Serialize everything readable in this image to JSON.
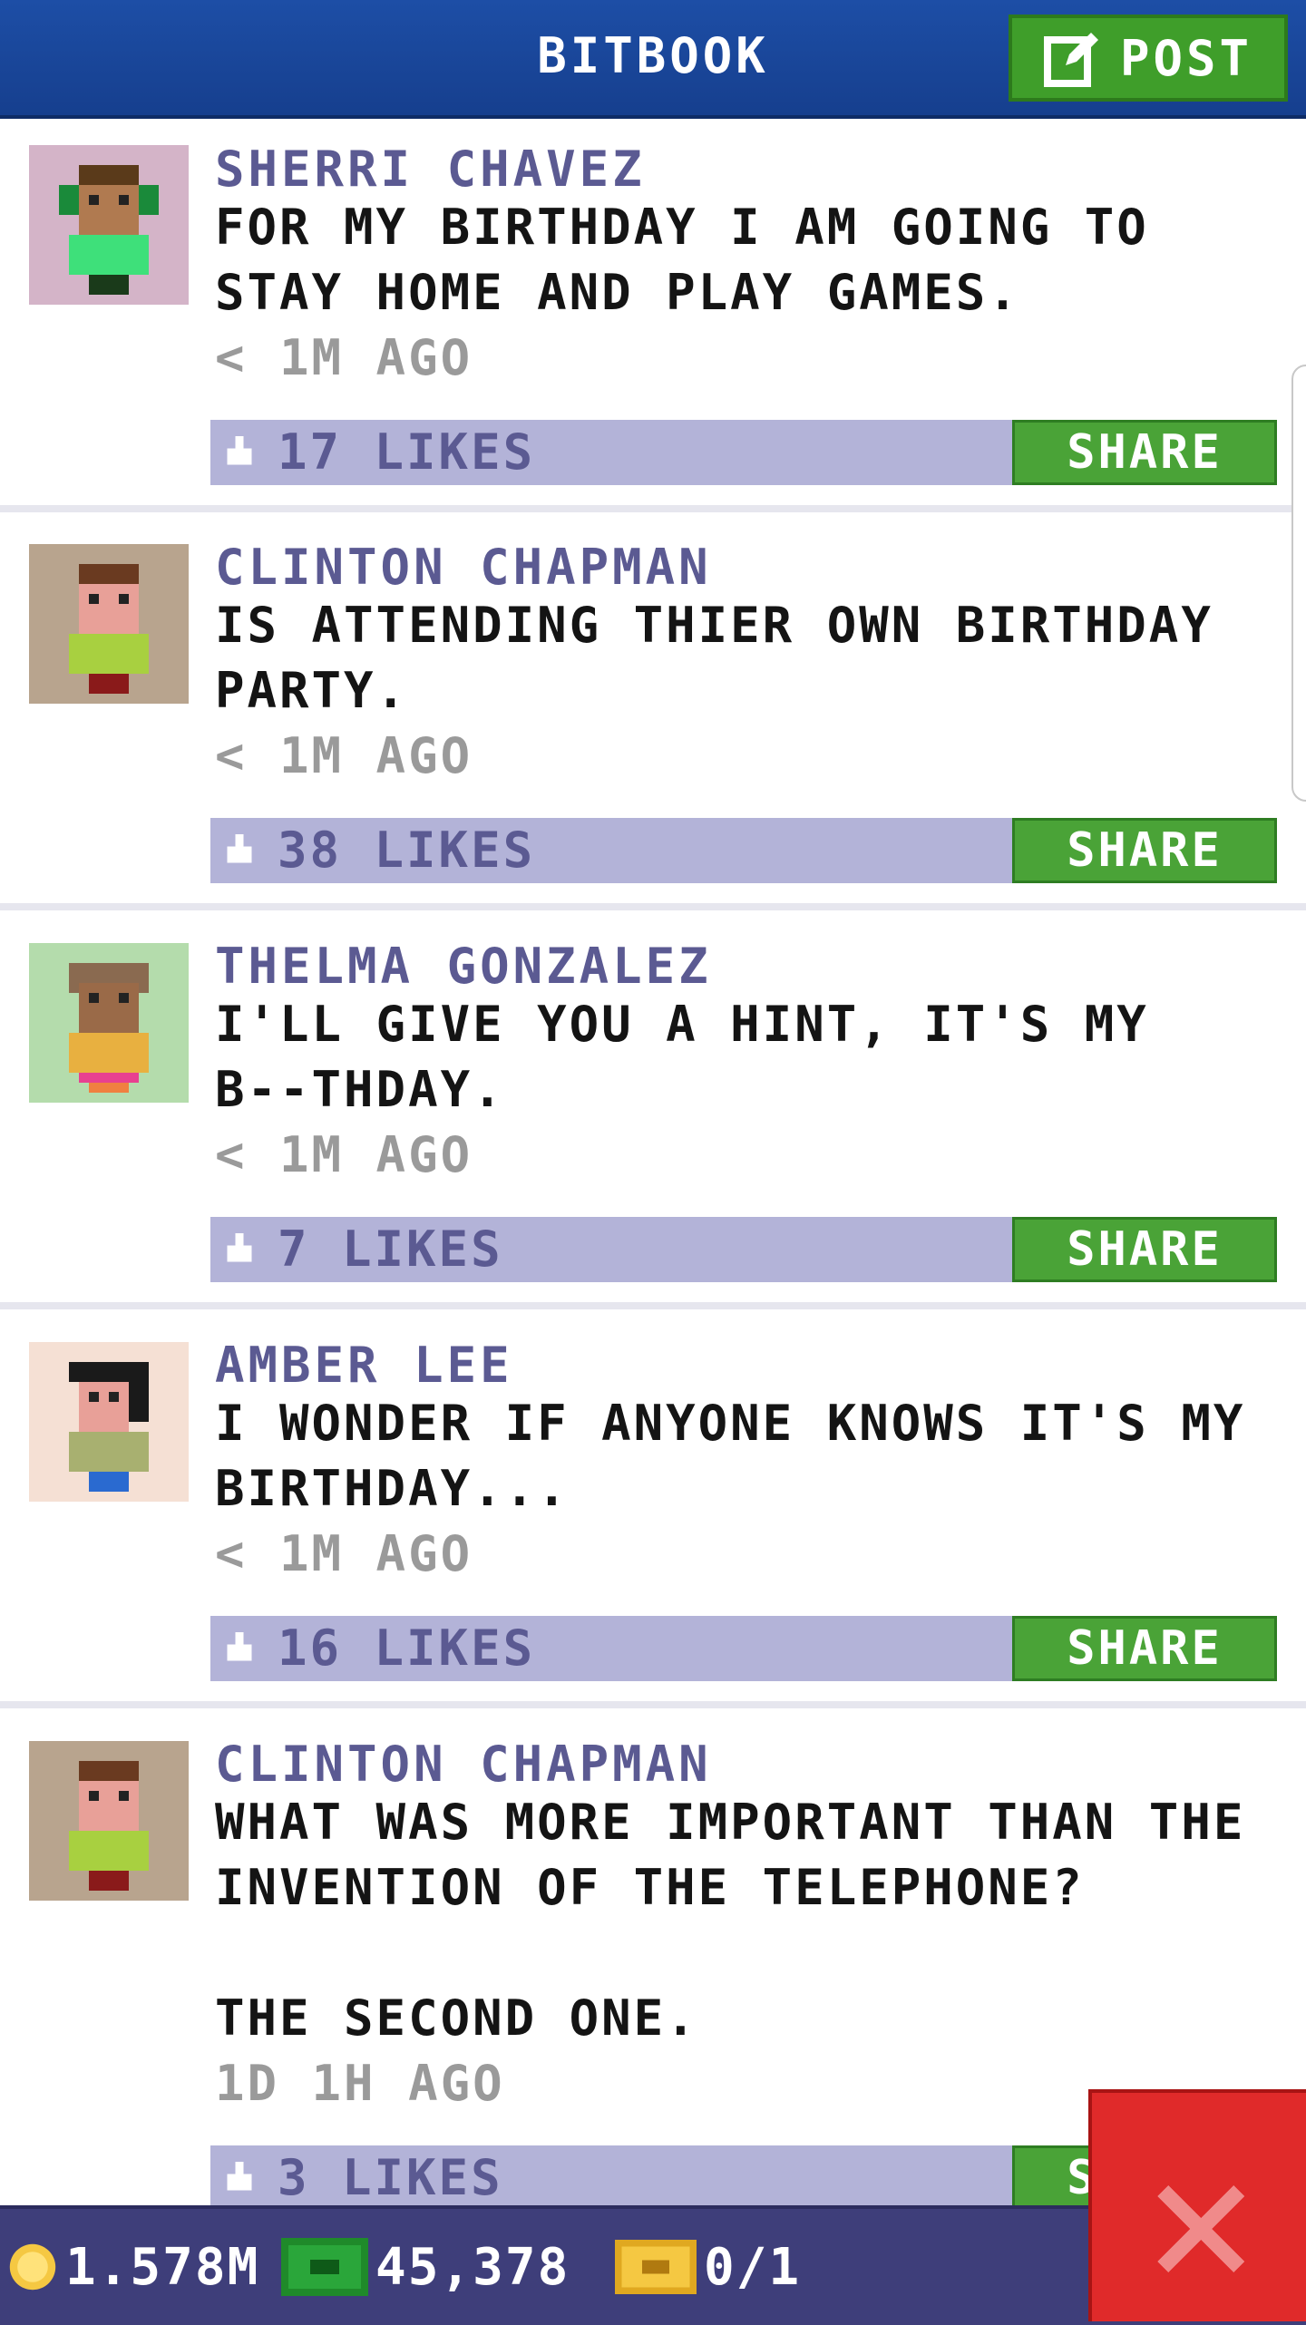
{
  "header": {
    "title": "BITBOOK",
    "post_label": "POST"
  },
  "posts": [
    {
      "name": "SHERRI CHAVEZ",
      "message": "FOR MY BIRTHDAY I AM GOING TO\nSTAY HOME AND PLAY GAMES.",
      "time": "< 1M AGO",
      "likes": "17 LIKES",
      "share": "SHARE",
      "avatar_bg": "#d4b4c8"
    },
    {
      "name": "CLINTON CHAPMAN",
      "message": "IS ATTENDING THIER OWN BIRTHDAY\nPARTY.",
      "time": "< 1M AGO",
      "likes": "38 LIKES",
      "share": "SHARE",
      "avatar_bg": "#b8a48e"
    },
    {
      "name": "THELMA GONZALEZ",
      "message": "I'LL GIVE YOU A HINT, IT'S MY\nB--THDAY.",
      "time": "< 1M AGO",
      "likes": "7 LIKES",
      "share": "SHARE",
      "avatar_bg": "#b4dcac"
    },
    {
      "name": "AMBER LEE",
      "message": "I WONDER IF ANYONE KNOWS IT'S MY\nBIRTHDAY...",
      "time": "< 1M AGO",
      "likes": "16 LIKES",
      "share": "SHARE",
      "avatar_bg": "#f5e0d4"
    },
    {
      "name": "CLINTON CHAPMAN",
      "message": "WHAT WAS MORE IMPORTANT THAN THE\nINVENTION OF THE TELEPHONE?\n\nTHE SECOND ONE.",
      "time": "1D 1H AGO",
      "likes": "3 LIKES",
      "share": "SHARE",
      "avatar_bg": "#b8a48e"
    }
  ],
  "status": {
    "coins": "1.578M",
    "bux": "45,378",
    "tickets": "0/1"
  },
  "colors": {
    "header": "#1d4ea6",
    "accent_green": "#4aa337",
    "likebar": "#b3b3d8",
    "name": "#5b5a92",
    "close": "#e02a2a"
  }
}
